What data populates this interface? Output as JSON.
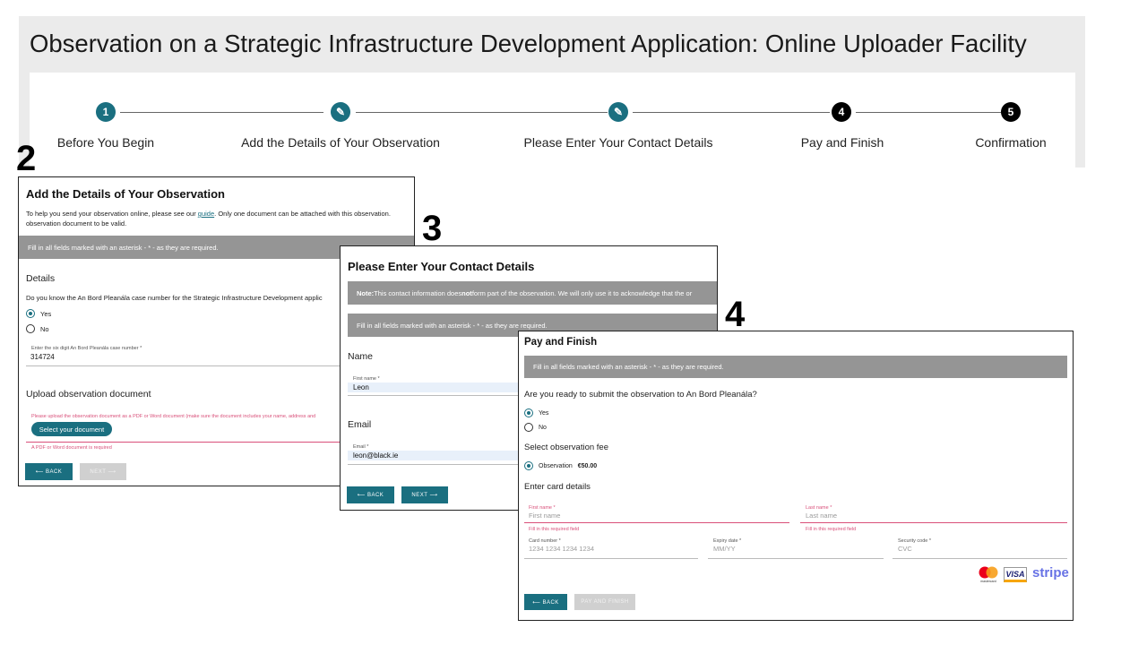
{
  "page": {
    "title": "Observation on a Strategic Infrastructure Development Application: Online Uploader Facility"
  },
  "stepper": {
    "steps": [
      {
        "marker": "1",
        "label": "Before You Begin"
      },
      {
        "marker": "✎",
        "label": "Add the Details of Your Observation"
      },
      {
        "marker": "✎",
        "label": "Please Enter Your Contact Details"
      },
      {
        "marker": "4",
        "label": "Pay and Finish"
      },
      {
        "marker": "5",
        "label": "Confirmation"
      }
    ]
  },
  "screen_numbers": [
    "2",
    "3",
    "4"
  ],
  "details_panel": {
    "title": "Add the Details of Your Observation",
    "intro_before_link": "To help you send your observation online, please see our ",
    "intro_link": "guide",
    "intro_after_link": ". Only one document can be attached with this observation.",
    "intro_line2": "observation document to be valid.",
    "required_notice": "Fill in all fields marked with an asterisk - * - as they are required.",
    "details_heading": "Details",
    "case_question": "Do you know the An Bord Pleanála case number for the Strategic Infrastructure Development applic",
    "yes_label": "Yes",
    "no_label": "No",
    "case_field_label": "Enter the six digit An Bord Pleanála case number *",
    "case_field_value": "314724",
    "upload_heading": "Upload observation document",
    "upload_instructions": "Please upload the observation document as a PDF or Word document (make sure the document includes your name, address and",
    "select_button": "Select your document",
    "upload_error": "A PDF or Word document is required",
    "back_button": "⟵ BACK",
    "next_button": "NEXT ⟶"
  },
  "contact_panel": {
    "title": "Please Enter Your Contact Details",
    "note_bold": "Note:",
    "note_text": " This contact information does ",
    "note_not": "not",
    "note_rest": " form part of the observation. We will only use it to acknowledge that the or",
    "required_notice": "Fill in all fields marked with an asterisk - * - as they are required.",
    "name_heading": "Name",
    "first_name_label": "First name *",
    "first_name_value": "Leon",
    "email_heading": "Email",
    "email_label": "Email *",
    "email_value": "leon@black.ie",
    "back_button": "⟵ BACK",
    "next_button": "NEXT ⟶"
  },
  "pay_panel": {
    "title": "Pay and Finish",
    "required_notice": "Fill in all fields marked with an asterisk - * - as they are required.",
    "ready_question": "Are you ready to submit the observation to An Bord Pleanála?",
    "yes_label": "Yes",
    "no_label": "No",
    "fee_heading": "Select observation fee",
    "fee_option_label": "Observation",
    "fee_amount": "€50.00",
    "card_heading": "Enter card details",
    "first_name_label": "First name *",
    "first_name_placeholder": "First name",
    "last_name_label": "Last name *",
    "last_name_placeholder": "Last name",
    "required_error": "Fill in this required field",
    "card_number_label": "Card number *",
    "card_number_placeholder": "1234 1234 1234 1234",
    "expiry_label": "Expiry date *",
    "expiry_placeholder": "MM/YY",
    "cvc_label": "Security code *",
    "cvc_placeholder": "CVC",
    "mastercard_text": "mastercard",
    "visa_text": "VISA",
    "stripe_text": "stripe",
    "back_button": "⟵ BACK",
    "pay_button": "PAY AND FINISH"
  },
  "colors": {
    "accent": "#1a6f80",
    "error": "#d9507a",
    "notice_bar": "#959595"
  }
}
